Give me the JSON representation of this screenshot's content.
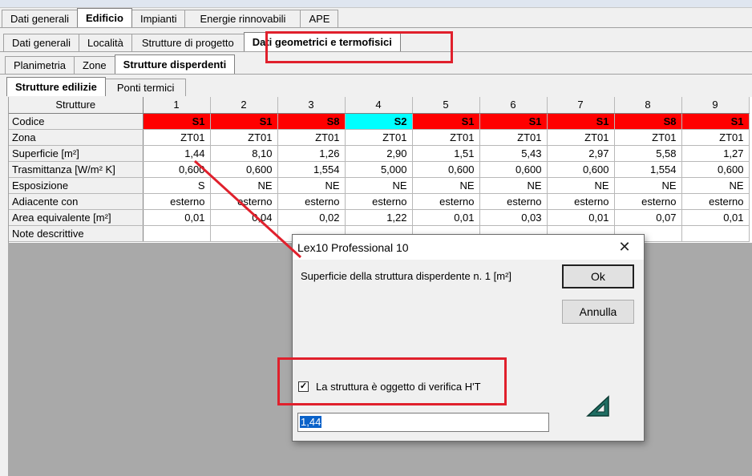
{
  "tabs_level1": [
    "Dati generali",
    "Edificio",
    "Impianti",
    "Energie rinnovabili",
    "APE"
  ],
  "tabs_level1_active": 1,
  "tabs_level2": [
    "Dati generali",
    "Località",
    "Strutture di progetto",
    "Dati geometrici e termofisici"
  ],
  "tabs_level2_active": 3,
  "tabs_level3": [
    "Planimetria",
    "Zone",
    "Strutture disperdenti"
  ],
  "tabs_level3_active": 2,
  "tabs_level4": [
    "Strutture edilizie",
    "Ponti termici"
  ],
  "tabs_level4_active": 0,
  "grid": {
    "header_label": "Strutture",
    "columns": [
      "1",
      "2",
      "3",
      "4",
      "5",
      "6",
      "7",
      "8",
      "9"
    ],
    "rows": [
      {
        "label": "Codice",
        "values": [
          "S1",
          "S1",
          "S8",
          "S2",
          "S1",
          "S1",
          "S1",
          "S8",
          "S1"
        ]
      },
      {
        "label": "Zona",
        "values": [
          "ZT01",
          "ZT01",
          "ZT01",
          "ZT01",
          "ZT01",
          "ZT01",
          "ZT01",
          "ZT01",
          "ZT01"
        ]
      },
      {
        "label": "Superficie [m²]",
        "values": [
          "1,44",
          "8,10",
          "1,26",
          "2,90",
          "1,51",
          "5,43",
          "2,97",
          "5,58",
          "1,27"
        ]
      },
      {
        "label": "Trasmittanza [W/m² K]",
        "values": [
          "0,600",
          "0,600",
          "1,554",
          "5,000",
          "0,600",
          "0,600",
          "0,600",
          "1,554",
          "0,600"
        ]
      },
      {
        "label": "Esposizione",
        "values": [
          "S",
          "NE",
          "NE",
          "NE",
          "NE",
          "NE",
          "NE",
          "NE",
          "NE"
        ]
      },
      {
        "label": "Adiacente con",
        "values": [
          "esterno",
          "esterno",
          "esterno",
          "esterno",
          "esterno",
          "esterno",
          "esterno",
          "esterno",
          "esterno"
        ]
      },
      {
        "label": "Area equivalente [m²]",
        "values": [
          "0,01",
          "0,04",
          "0,02",
          "1,22",
          "0,01",
          "0,03",
          "0,01",
          "0,07",
          "0,01"
        ]
      },
      {
        "label": "Note descrittive",
        "values": [
          "",
          "",
          "",
          "",
          "",
          "",
          "",
          "",
          ""
        ]
      }
    ],
    "code_colors": [
      "#ff0000",
      "#ff0000",
      "#ff0000",
      "#00ffff",
      "#ff0000",
      "#ff0000",
      "#ff0000",
      "#ff0000",
      "#ff0000"
    ]
  },
  "dialog": {
    "title": "Lex10 Professional 10",
    "close_glyph": "✕",
    "message": "Superficie della struttura disperdente n. 1 [m²]",
    "ok_label": "Ok",
    "cancel_label": "Annulla",
    "checkbox_label": "La struttura è oggetto di verifica H'T",
    "checkbox_checked": true,
    "input_value": "1,44"
  },
  "colors": {
    "highlight": "#e0202c",
    "arrow": "#e0202c",
    "selection": "#0a62c9"
  }
}
